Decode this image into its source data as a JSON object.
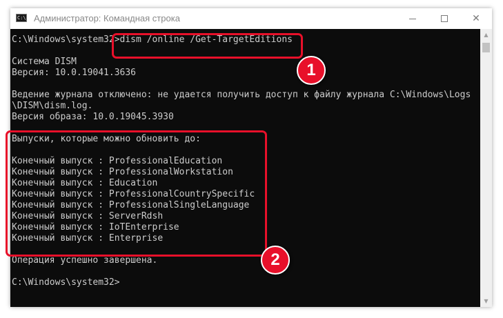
{
  "window": {
    "title": "Администратор: Командная строка",
    "icon_label": "C:\\",
    "minimize_glyph": "",
    "maximize_glyph": "",
    "close_glyph": "✕"
  },
  "console": {
    "lines": [
      "C:\\Windows\\system32>dism /online /Get-TargetEditions",
      "",
      "Система DISM",
      "Версия: 10.0.19041.3636",
      "",
      "Ведение журнала отключено: не удается получить доступ к файлу журнала C:\\Windows\\Logs",
      "\\DISM\\dism.log.",
      "Версия образа: 10.0.19045.3930",
      "",
      "Выпуски, которые можно обновить до:",
      "",
      "Конечный выпуск : ProfessionalEducation",
      "Конечный выпуск : ProfessionalWorkstation",
      "Конечный выпуск : Education",
      "Конечный выпуск : ProfessionalCountrySpecific",
      "Конечный выпуск : ProfessionalSingleLanguage",
      "Конечный выпуск : ServerRdsh",
      "Конечный выпуск : IoTEnterprise",
      "Конечный выпуск : Enterprise",
      "",
      "Операция успешно завершена.",
      "",
      "C:\\Windows\\system32>"
    ]
  },
  "scrollbar": {
    "up_glyph": "▲",
    "down_glyph": "▼"
  },
  "annotations": {
    "badge_1": "1",
    "badge_2": "2",
    "color": "#e8102a"
  },
  "colors": {
    "console_bg": "#0c0c0c",
    "console_text": "#cccccc"
  }
}
